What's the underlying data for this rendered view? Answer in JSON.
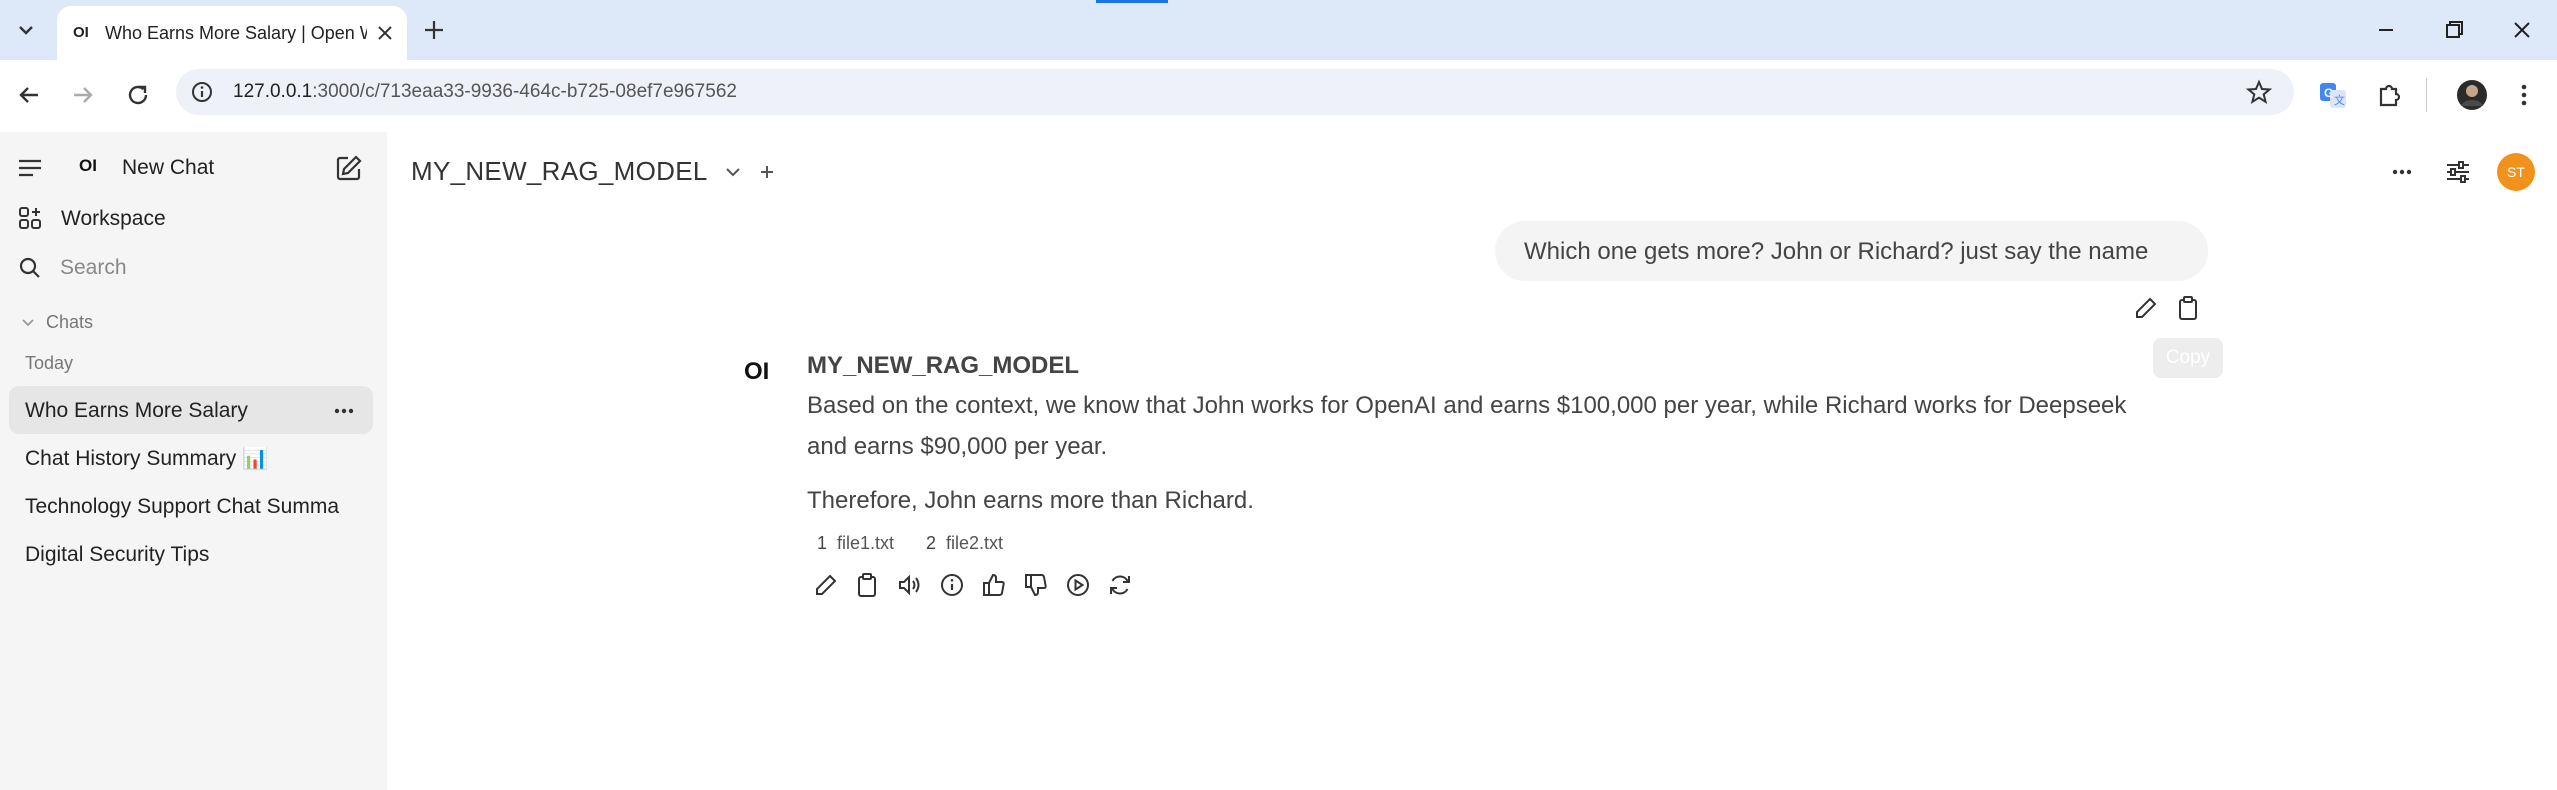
{
  "browser": {
    "tab_title": "Who Earns More Salary | Open W",
    "tab_favicon": "OI",
    "url_host": "127.0.0.1",
    "url_path": ":3000/c/713eaa33-9936-464c-b725-08ef7e967562"
  },
  "sidebar": {
    "logo": "OI",
    "new_chat": "New Chat",
    "workspace": "Workspace",
    "search_placeholder": "Search",
    "chats_header": "Chats",
    "today_label": "Today",
    "chats": [
      {
        "label": "Who Earns More Salary",
        "active": true
      },
      {
        "label": "Chat History Summary 📊",
        "active": false
      },
      {
        "label": "Technology Support Chat Summa",
        "active": false
      },
      {
        "label": "Digital Security Tips",
        "active": false
      }
    ]
  },
  "header": {
    "model_name": "MY_NEW_RAG_MODEL",
    "avatar_initials": "ST",
    "avatar_color": "#f2921d"
  },
  "conversation": {
    "user_message": "Which one gets more? John or Richard? just say the name",
    "copy_tooltip": "Copy",
    "assistant_logo": "OI",
    "assistant_name": "MY_NEW_RAG_MODEL",
    "assistant_line1": "Based on the context, we know that John works for OpenAI and earns $100,000 per year, while Richard works for Deepseek",
    "assistant_line2": "and earns $90,000 per year.",
    "assistant_line3": "Therefore, John earns more than Richard.",
    "sources": [
      {
        "num": "1",
        "name": "file1.txt"
      },
      {
        "num": "2",
        "name": "file2.txt"
      }
    ]
  }
}
